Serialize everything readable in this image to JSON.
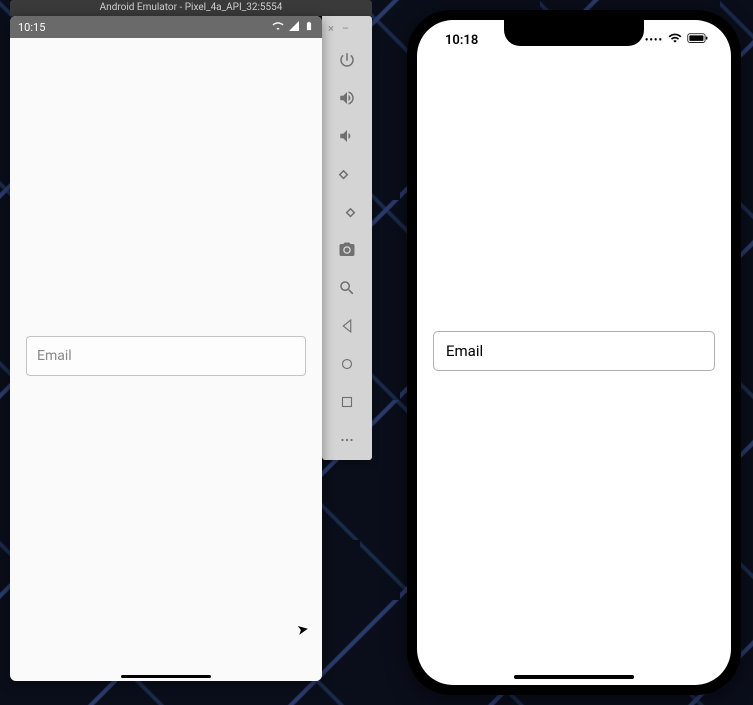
{
  "android": {
    "window_title": "Android Emulator - Pixel_4a_API_32:5554",
    "status_time": "10:15",
    "input_placeholder": "Email"
  },
  "emulator_toolbar": {
    "close_label": "×",
    "minimize_label": "–",
    "buttons": [
      "power",
      "volume-up",
      "volume-down",
      "rotate-left",
      "rotate-right",
      "camera",
      "zoom",
      "back",
      "home",
      "overview",
      "more"
    ]
  },
  "ios": {
    "status_time": "10:18",
    "input_placeholder": "Email"
  }
}
